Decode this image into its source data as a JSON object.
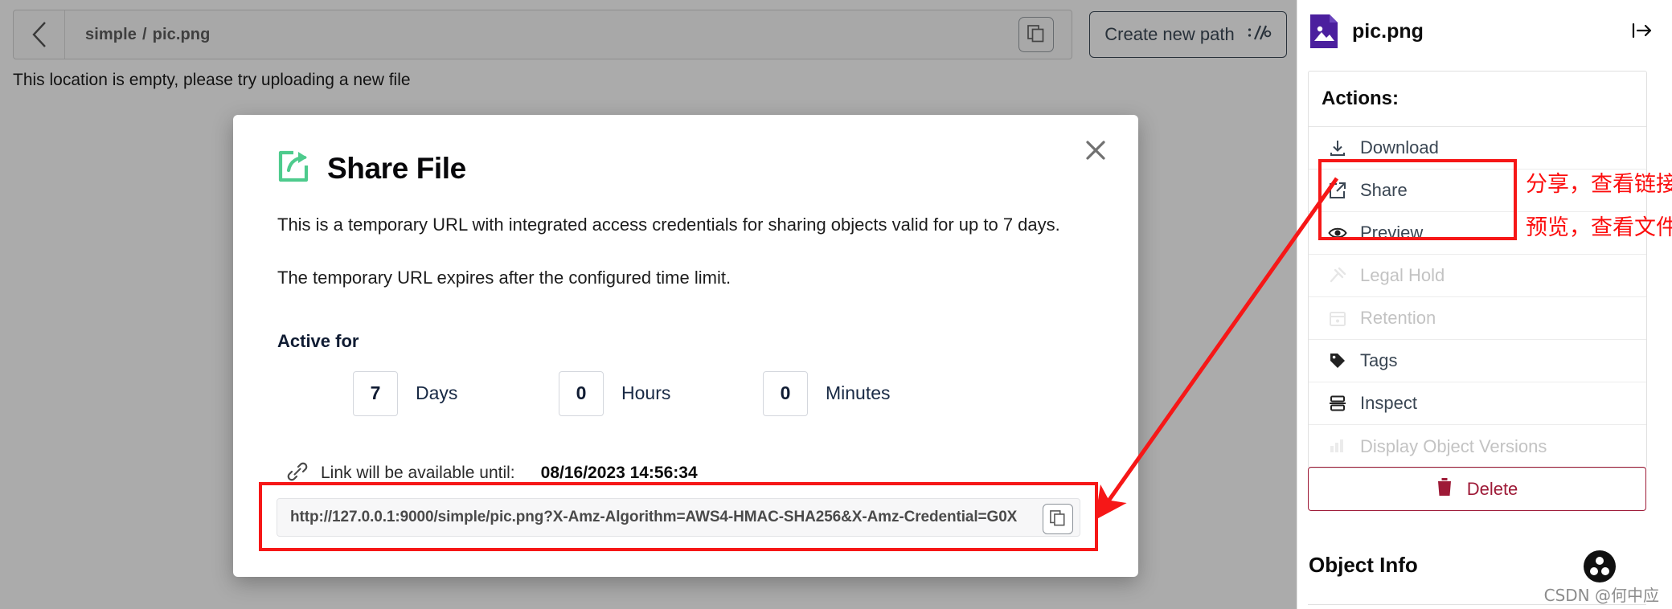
{
  "breadcrumb": {
    "back_icon": "chevron-left-icon",
    "parent": "simple",
    "separator": "/",
    "current": "pic.png",
    "copy_icon": "copy-icon"
  },
  "toolbar": {
    "create_path_label": "Create new path",
    "create_path_icon": "path-slash-icon"
  },
  "page": {
    "empty_message": "This location is empty, please try uploading a new file"
  },
  "modal": {
    "title": "Share File",
    "title_icon": "share-file-icon",
    "close_icon": "close-icon",
    "paragraph_1": "This is a temporary URL with integrated access credentials for sharing objects valid for up to 7 days.",
    "paragraph_2": "The temporary URL expires after the configured time limit.",
    "active_for_label": "Active for",
    "duration": [
      {
        "value": "7",
        "unit": "Days"
      },
      {
        "value": "0",
        "unit": "Hours"
      },
      {
        "value": "0",
        "unit": "Minutes"
      }
    ],
    "link_icon": "link-icon",
    "link_until_label": "Link will be available until:",
    "link_until_value": "08/16/2023 14:56:34",
    "url_value": "http://127.0.0.1:9000/simple/pic.png?X-Amz-Algorithm=AWS4-HMAC-SHA256&X-Amz-Credential=G0X",
    "url_copy_icon": "copy-icon"
  },
  "sidebar": {
    "file_icon": "image-file-icon",
    "file_name": "pic.png",
    "collapse_icon": "collapse-right-icon",
    "actions_title": "Actions:",
    "actions": [
      {
        "label": "Download",
        "icon": "download-icon",
        "disabled": false
      },
      {
        "label": "Share",
        "icon": "share-icon",
        "disabled": false
      },
      {
        "label": "Preview",
        "icon": "eye-icon",
        "disabled": false
      },
      {
        "label": "Legal Hold",
        "icon": "gavel-icon",
        "disabled": true
      },
      {
        "label": "Retention",
        "icon": "calendar-icon",
        "disabled": true
      },
      {
        "label": "Tags",
        "icon": "tag-icon",
        "disabled": false
      },
      {
        "label": "Inspect",
        "icon": "inspect-icon",
        "disabled": false
      },
      {
        "label": "Display Object Versions",
        "icon": "versions-icon",
        "disabled": true
      }
    ],
    "delete_label": "Delete",
    "delete_icon": "trash-icon",
    "object_info_title": "Object Info",
    "console_logo_icon": "minio-logo-icon"
  },
  "annotations": {
    "share_note": "分享，查看链接",
    "preview_note": "预览，查看文件",
    "highlight_color": "#f61717"
  },
  "watermark": {
    "text": "CSDN @何中应"
  }
}
